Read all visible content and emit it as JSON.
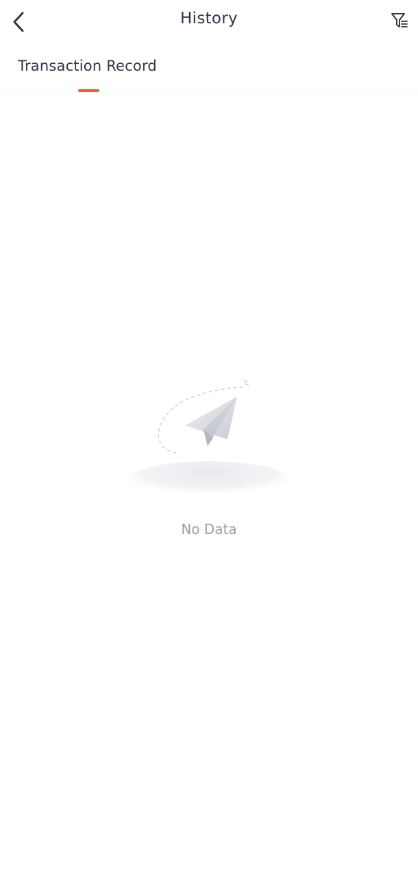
{
  "header": {
    "title": "History",
    "back_icon": "chevron-left-icon",
    "filter_icon": "filter-list-icon"
  },
  "tabs": [
    {
      "label": "Transaction Record",
      "active": true
    }
  ],
  "empty_state": {
    "text": "No Data",
    "icon": "paper-plane-icon"
  },
  "colors": {
    "text_primary": "#2f3648",
    "accent": "#e0663a",
    "muted": "#9a9ea8",
    "divider": "#eeeff2"
  }
}
